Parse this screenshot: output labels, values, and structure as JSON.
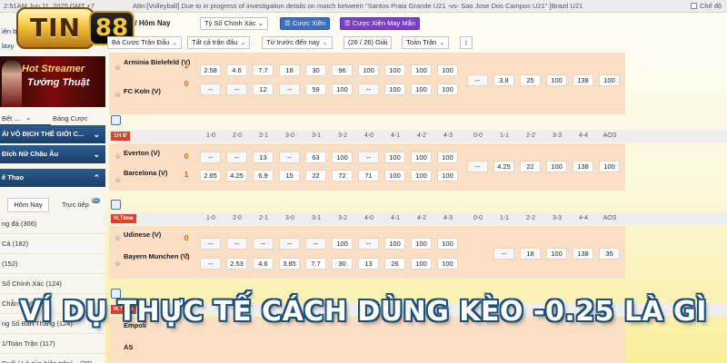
{
  "topbar": {
    "time": "2:51AM Jun 11, 2025 GMT +7",
    "ticker": "Attn:[Volleyball] Due to in progress of investigation details on match between \"Santos Praia Grande U21 -vs- Sao Jose Dos Campos U21\" [Brazil U21",
    "toggle_label": "Chế độ"
  },
  "logo": {
    "tin": "TIN",
    "num": "88"
  },
  "sidebar": {
    "line1": "iên b...",
    "line2": "laxy",
    "banner_line1": "Hot Streamer",
    "banner_line2": "Tướng Thuật",
    "tab_a": "Bết ...",
    "tab_b": "Bảng Cược",
    "sections": [
      "ẢI VÔ ĐỊCH THẾ GIỚI C...",
      "Đích Nữ Châu Âu",
      "ể Thao"
    ],
    "tab_hom_nay": "Hôm Nay",
    "tab_truc_tiep": "Trực tiếp",
    "tab_badge": "82",
    "items": [
      "ng đá (306)",
      "Cá (182)",
      "(152)",
      "Số Chính Xác (124)",
      "Chẵn (156)",
      "ng Số Bàn Thắng (124)",
      "1/Toàn Trận (117)",
      "Đuối / Lẻ của hiệp trận/... (28)"
    ]
  },
  "header": {
    "title": "i / Hôm Nay",
    "btn_ty_so": "Tỷ Số Chính Xác",
    "btn_cuoc_xien": "Cược Xiên",
    "btn_may_man": "Cược Xiên May Mắn"
  },
  "filters": {
    "f1": "Bá Cược Trận Đấu",
    "f2": "Tất cả trận đấu",
    "f3": "Từ trước đến nay",
    "count": "(26 / 26) Giải",
    "f4": "Toàn Trận"
  },
  "match1": {
    "home": "Arminia Bielefeld (V)",
    "away": "FC Koln (V)",
    "home_score": "1",
    "away_score": "0",
    "row1": [
      "2.58",
      "4.6",
      "7.7",
      "18",
      "30",
      "96",
      "100",
      "100",
      "100",
      "100"
    ],
    "row2": [
      "--",
      "--",
      "12",
      "--",
      "59",
      "100",
      "--",
      "100",
      "100",
      "100"
    ],
    "right": [
      "--",
      "3.8",
      "25",
      "100",
      "138",
      "100"
    ]
  },
  "section2": {
    "label": "1H 6'",
    "scores": [
      "1-0",
      "2-0",
      "2-1",
      "3-0",
      "3-1",
      "3-2",
      "4-0",
      "4-1",
      "4-2",
      "4-3",
      "0-0",
      "1-1",
      "2-2",
      "3-3",
      "4-4",
      "AOS"
    ]
  },
  "match2": {
    "home": "Everton (V)",
    "away": "Barcelona (V)",
    "home_score": "0",
    "away_score": "1",
    "row1": [
      "--",
      "--",
      "13",
      "--",
      "63",
      "100",
      "--",
      "100",
      "100",
      "100"
    ],
    "row2": [
      "2.65",
      "4.25",
      "6.9",
      "15",
      "22",
      "72",
      "71",
      "100",
      "100",
      "100"
    ],
    "right": [
      "--",
      "4.25",
      "22",
      "100",
      "138",
      "100"
    ]
  },
  "section3": {
    "label": "H.Time",
    "scores": [
      "1-0",
      "2-0",
      "2-1",
      "3-0",
      "3-1",
      "3-2",
      "4-0",
      "4-1",
      "4-2",
      "4-3",
      "0-0",
      "1-1",
      "2-2",
      "3-3",
      "4-4",
      "AOS"
    ]
  },
  "match3": {
    "home": "Udinese (V)",
    "away": "Bayern Munchen (V)",
    "home_score": "0",
    "away_score": "2",
    "row1": [
      "--",
      "--",
      "--",
      "--",
      "--",
      "100",
      "--",
      "100",
      "100",
      "100"
    ],
    "row2": [
      "--",
      "2.53",
      "4.6",
      "3.85",
      "7.7",
      "30",
      "13",
      "26",
      "100",
      "100"
    ],
    "right": [
      "--",
      "18",
      "100",
      "138",
      "35"
    ]
  },
  "section4": {
    "label": "H.Time"
  },
  "match4": {
    "home": "Empoli",
    "away": "AS"
  },
  "headline": "VÍ DỤ THỰC TẾ CÁCH DÙNG KÈO -0.25 LÀ GÌ",
  "colors": {
    "accent_blue": "#3c6fc2",
    "purple": "#7b3fc6",
    "band": "#fbdfc4",
    "score_orange": "#e05a00",
    "headline_outline": "#1d4f7a"
  }
}
